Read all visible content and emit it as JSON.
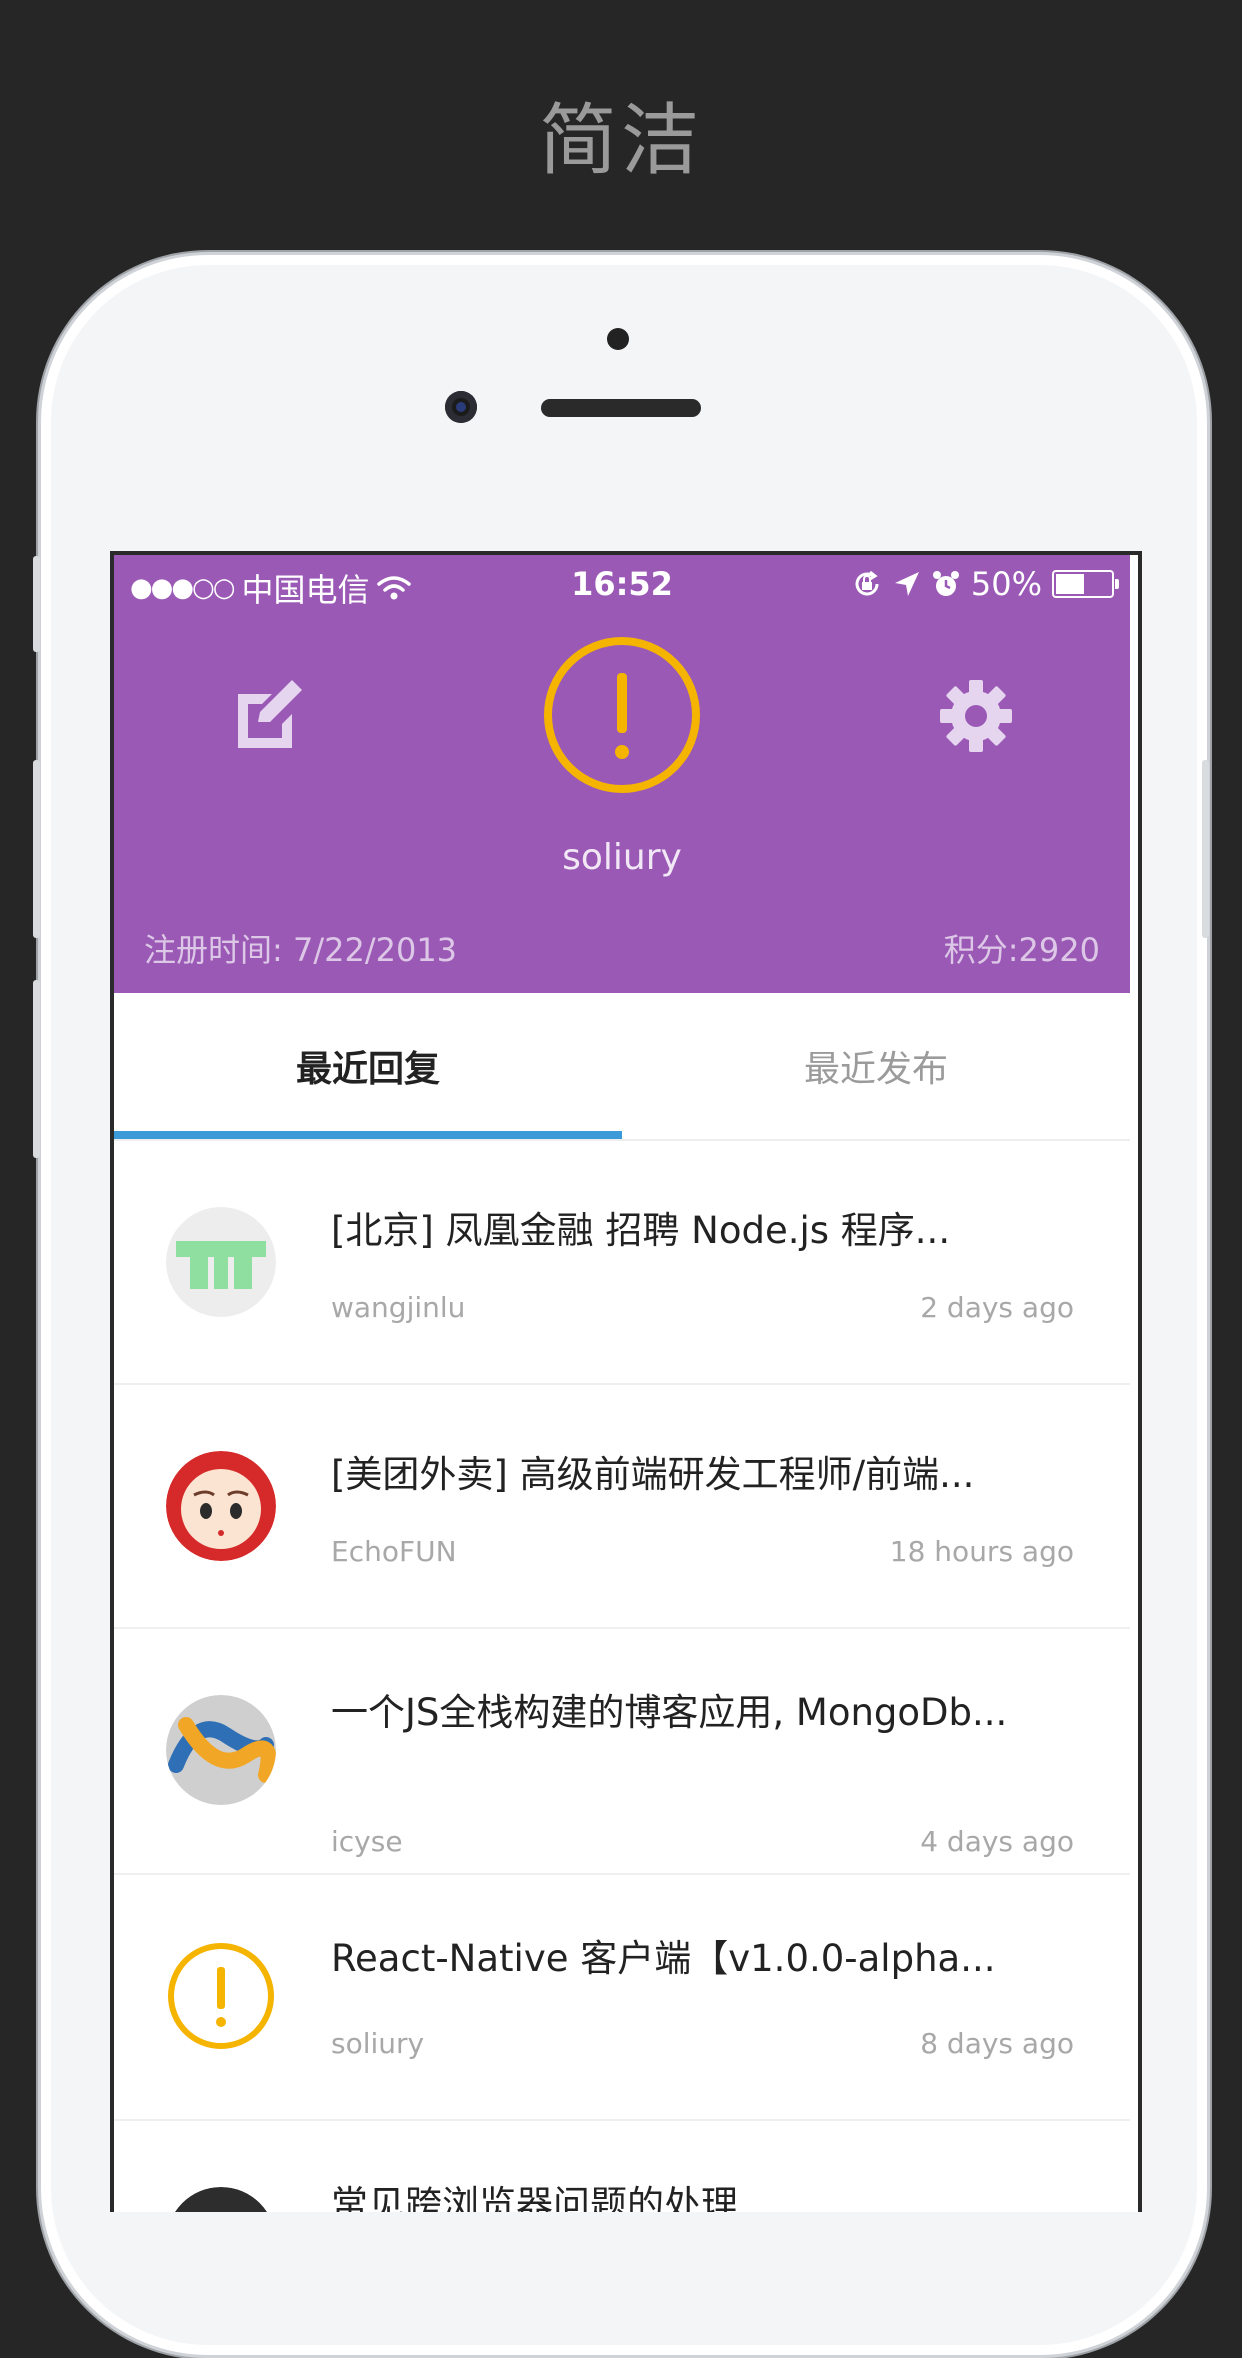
{
  "marketing": {
    "title": "简洁"
  },
  "statusbar": {
    "signal": "●●●○○",
    "carrier": "中国电信",
    "time": "16:52",
    "battery_percent": "50%",
    "battery_level": 0.5
  },
  "profile": {
    "username": "soliury",
    "register_time": "注册时间: 7/22/2013",
    "score": "积分:2920"
  },
  "tabs": [
    {
      "label": "最近回复",
      "active": true
    },
    {
      "label": "最近发布",
      "active": false
    }
  ],
  "topics": [
    {
      "title": "[北京] 凤凰金融 招聘 Node.js 程序...",
      "author": "wangjinlu",
      "time": "2 days ago",
      "avatar": "meteor-logo-avatar"
    },
    {
      "title": "[美团外卖] 高级前端研发工程师/前端...",
      "author": "EchoFUN",
      "time": "18 hours ago",
      "avatar": "cartoon-face-avatar"
    },
    {
      "title": "一个JS全栈构建的博客应用, MongoDb...",
      "author": "icyse",
      "time": "4 days ago",
      "avatar": "rope-knot-avatar"
    },
    {
      "title": "React-Native 客户端【v1.0.0-alpha...",
      "author": "soliury",
      "time": "8 days ago",
      "avatar": "exclamation-avatar"
    },
    {
      "title": "常见跨浏览器问题的处理",
      "author": "",
      "time": "",
      "avatar": "dark-photo-avatar"
    }
  ],
  "colors": {
    "header": "#9b59b6",
    "accent": "#f5b400",
    "tab_indicator": "#3d9ad8",
    "background": "#262626"
  }
}
